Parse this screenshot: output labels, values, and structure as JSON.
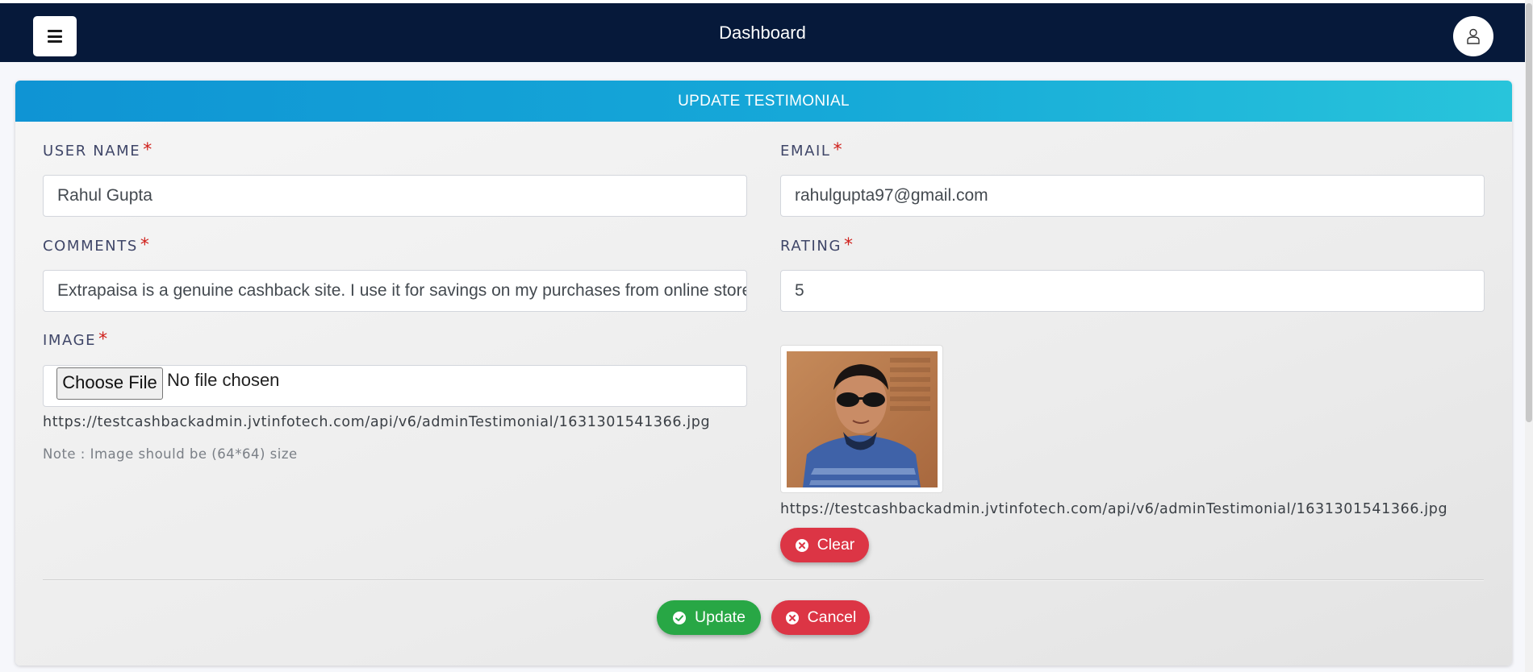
{
  "topbar": {
    "title": "Dashboard",
    "menu_icon": "hamburger-icon",
    "user_icon": "user-icon",
    "bg_color": "#06193a"
  },
  "form": {
    "header": "UPDATE TESTIMONIAL",
    "required_mark": "*",
    "user_name": {
      "label": "USER NAME",
      "value": "Rahul Gupta"
    },
    "email": {
      "label": "EMAIL",
      "value": "rahulgupta97@gmail.com"
    },
    "comments": {
      "label": "COMMENTS",
      "value": "Extrapaisa is a genuine cashback site. I use it for savings on my purchases from online stores."
    },
    "rating": {
      "label": "RATING",
      "value": "5"
    },
    "image": {
      "label": "IMAGE",
      "choose_file_label": "Choose File",
      "file_status": "No file chosen",
      "url": "https://testcashbackadmin.jvtinfotech.com/api/v6/adminTestimonial/1631301541366.jpg",
      "note": "Note : Image should be (64*64) size"
    },
    "preview": {
      "url": "https://testcashbackadmin.jvtinfotech.com/api/v6/adminTestimonial/1631301541366.jpg",
      "clear_label": "Clear"
    },
    "actions": {
      "update_label": "Update",
      "cancel_label": "Cancel"
    }
  },
  "colors": {
    "header_gradient_start": "#0f94d4",
    "header_gradient_end": "#28c4db",
    "danger": "#dc3545",
    "success": "#28a745",
    "required": "#d0211c"
  }
}
